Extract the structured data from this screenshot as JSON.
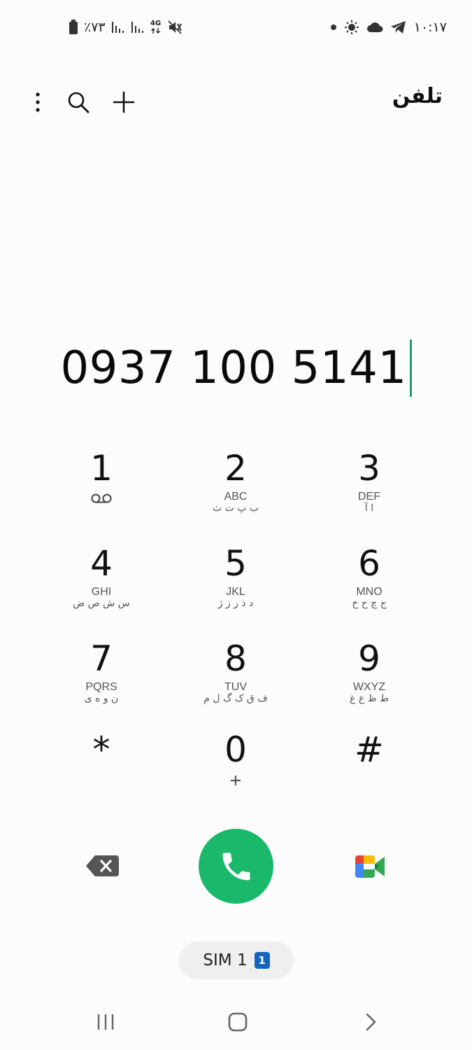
{
  "status_bar": {
    "battery_text": "٪۷۳",
    "network_label": "4G",
    "time": "۱۰:۱۷"
  },
  "header": {
    "title": "تلفن"
  },
  "dialer": {
    "number": "0937 100 5141"
  },
  "keypad": {
    "keys": [
      {
        "digit": "1",
        "letters": "",
        "persian": ""
      },
      {
        "digit": "2",
        "letters": "ABC",
        "persian": "ب پ ت ث"
      },
      {
        "digit": "3",
        "letters": "DEF",
        "persian": "ا آ"
      },
      {
        "digit": "4",
        "letters": "GHI",
        "persian": "س ش ص ض"
      },
      {
        "digit": "5",
        "letters": "JKL",
        "persian": "د ذ ر ز ژ"
      },
      {
        "digit": "6",
        "letters": "MNO",
        "persian": "ج چ ح خ"
      },
      {
        "digit": "7",
        "letters": "PQRS",
        "persian": "ن و ه ی"
      },
      {
        "digit": "8",
        "letters": "TUV",
        "persian": "ف ق ک گ ل م"
      },
      {
        "digit": "9",
        "letters": "WXYZ",
        "persian": "ط ظ ع غ"
      },
      {
        "digit": "*",
        "letters": "",
        "persian": ""
      },
      {
        "digit": "0",
        "letters": "",
        "persian": ""
      },
      {
        "digit": "#",
        "letters": "",
        "persian": ""
      }
    ]
  },
  "sim": {
    "label": "SIM 1",
    "badge": "1"
  },
  "colors": {
    "accent": "#1aa36a",
    "call_button": "#19b86a",
    "sim_badge": "#1565c0"
  },
  "icons": {
    "more": "more-vertical-icon",
    "search": "search-icon",
    "add": "plus-icon",
    "voicemail": "voicemail-icon",
    "backspace": "backspace-icon",
    "call": "phone-icon",
    "video": "video-call-icon",
    "recent_apps": "recent-apps-icon",
    "home": "home-icon",
    "back": "back-icon"
  }
}
